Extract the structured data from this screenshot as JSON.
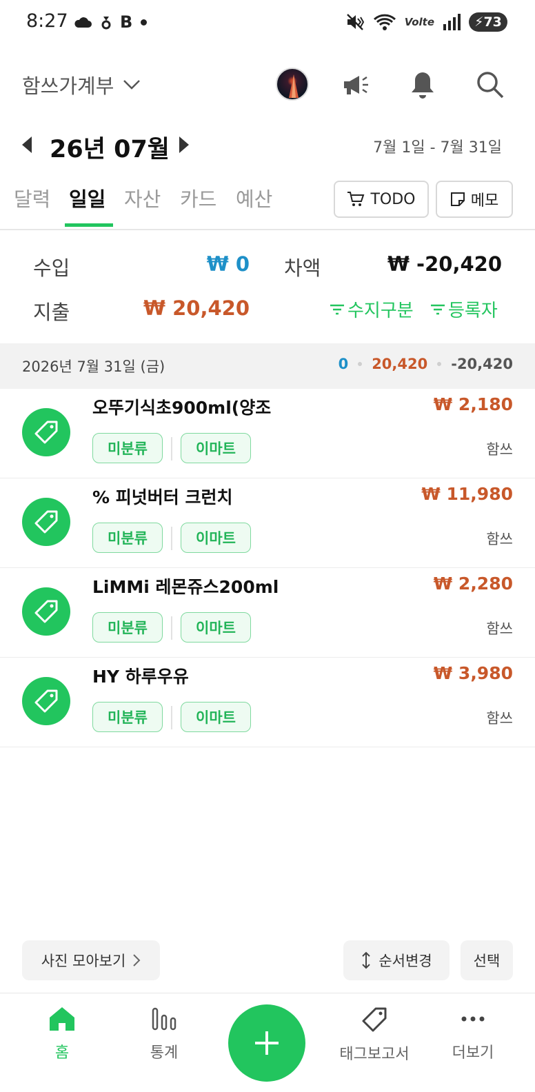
{
  "status": {
    "time": "8:27",
    "b_label": "B",
    "lte": "Volte",
    "battery": "73"
  },
  "header": {
    "title": "함쓰가계부"
  },
  "month": {
    "label": "26년 07월",
    "range": "7월 1일 - 7월 31일"
  },
  "tabs": [
    {
      "label": "달력"
    },
    {
      "label": "일일"
    },
    {
      "label": "자산"
    },
    {
      "label": "카드"
    },
    {
      "label": "예산"
    }
  ],
  "buttons": {
    "todo": "TODO",
    "memo": "메모"
  },
  "summary": {
    "income_label": "수입",
    "income": "₩ 0",
    "diff_label": "차액",
    "diff": "₩ -20,420",
    "expense_label": "지출",
    "expense": "₩ 20,420",
    "filter_type": "수지구분",
    "filter_user": "등록자"
  },
  "day": {
    "date": "2026년 7월 31일 (금)",
    "income": "0",
    "expense": "20,420",
    "diff": "-20,420"
  },
  "transactions": [
    {
      "name": "오뚜기식초900ml(양조",
      "amount": "₩ 2,180",
      "category": "미분류",
      "store": "이마트",
      "user": "함쓰"
    },
    {
      "name": "% 피넛버터 크런치",
      "amount": "₩ 11,980",
      "category": "미분류",
      "store": "이마트",
      "user": "함쓰"
    },
    {
      "name": "LiMMi 레몬쥬스200ml",
      "amount": "₩ 2,280",
      "category": "미분류",
      "store": "이마트",
      "user": "함쓰"
    },
    {
      "name": "HY 하루우유",
      "amount": "₩ 3,980",
      "category": "미분류",
      "store": "이마트",
      "user": "함쓰"
    }
  ],
  "actions": {
    "photos": "사진 모아보기",
    "reorder": "순서변경",
    "select": "선택"
  },
  "nav": {
    "home": "홈",
    "stats": "통계",
    "tags": "태그보고서",
    "more": "더보기"
  },
  "colors": {
    "accent": "#22c55e",
    "income": "#1e90c8",
    "expense": "#c8582a"
  }
}
